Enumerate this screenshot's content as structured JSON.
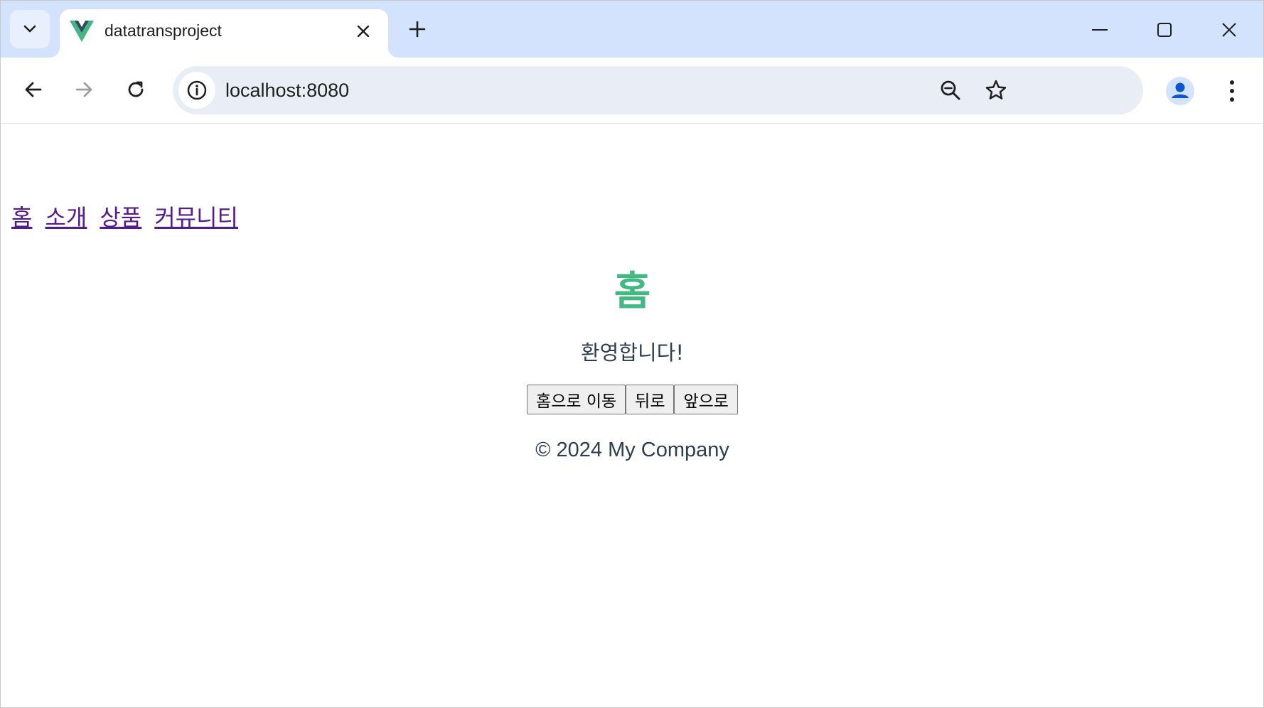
{
  "browser": {
    "tab": {
      "title": "datatransproject"
    },
    "address_bar": {
      "url": "localhost:8080"
    }
  },
  "page": {
    "nav_links": [
      {
        "label": "홈"
      },
      {
        "label": "소개"
      },
      {
        "label": "상품"
      },
      {
        "label": "커뮤니티"
      }
    ],
    "heading": "홈",
    "welcome_text": "환영합니다!",
    "buttons": {
      "home": "홈으로 이동",
      "back": "뒤로",
      "forward": "앞으로"
    },
    "footer": "© 2024 My Company"
  },
  "colors": {
    "heading": "#42b983",
    "text": "#2c3e50",
    "link_visited": "#551a8b",
    "tabstrip": "#d3e3fd",
    "omnibox": "#e9eef6"
  },
  "icons": {
    "tab_search": "chevron-down-icon",
    "favicon": "vue-logo-icon",
    "tab_close": "close-icon",
    "new_tab": "plus-icon",
    "minimize": "minimize-icon",
    "maximize": "maximize-icon",
    "window_close": "close-icon",
    "back": "arrow-left-icon",
    "forward": "arrow-right-icon",
    "reload": "reload-icon",
    "site_info": "info-icon",
    "zoom": "zoom-out-icon",
    "bookmark": "star-icon",
    "profile": "person-icon",
    "menu": "kebab-menu-icon"
  }
}
